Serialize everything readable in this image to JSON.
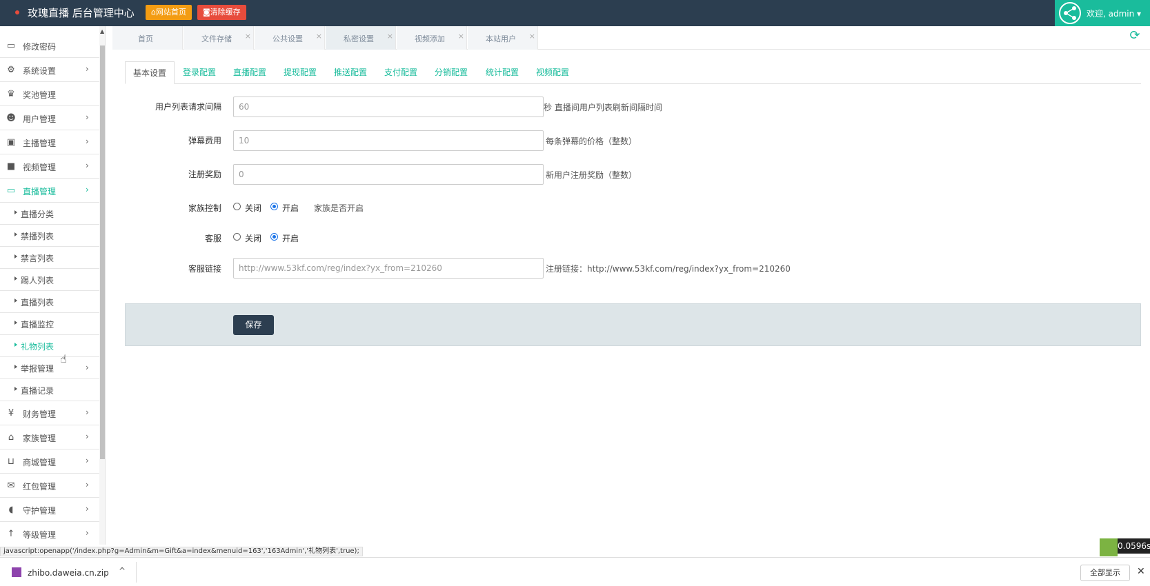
{
  "header": {
    "brand": "玫瑰直播 后台管理中心",
    "btn_home": "网站首页",
    "btn_cache": "清除缓存",
    "welcome": "欢迎, admin ▾"
  },
  "sidebar": {
    "items": [
      {
        "label": "修改密码",
        "icon": "monitor-icon",
        "arrow": false
      },
      {
        "label": "系统设置",
        "icon": "gears-icon",
        "arrow": true
      },
      {
        "label": "奖池管理",
        "icon": "trophy-icon",
        "arrow": false
      },
      {
        "label": "用户管理",
        "icon": "users-icon",
        "arrow": true
      },
      {
        "label": "主播管理",
        "icon": "id-badge-icon",
        "arrow": true
      },
      {
        "label": "视频管理",
        "icon": "video-camera-icon",
        "arrow": true
      },
      {
        "label": "直播管理",
        "icon": "desktop-icon",
        "arrow": true
      }
    ],
    "sub_items": [
      {
        "label": "直播分类"
      },
      {
        "label": "禁播列表"
      },
      {
        "label": "禁言列表"
      },
      {
        "label": "踢人列表"
      },
      {
        "label": "直播列表"
      },
      {
        "label": "直播监控"
      },
      {
        "label": "礼物列表"
      },
      {
        "label": "举报管理"
      },
      {
        "label": "直播记录"
      }
    ],
    "bottom_items": [
      {
        "label": "财务管理",
        "icon": "yen-icon"
      },
      {
        "label": "家族管理",
        "icon": "bank-icon"
      },
      {
        "label": "商城管理",
        "icon": "cart-icon"
      },
      {
        "label": "红包管理",
        "icon": "envelope-icon"
      },
      {
        "label": "守护管理",
        "icon": "shield-icon"
      },
      {
        "label": "等级管理",
        "icon": "level-up-icon"
      }
    ]
  },
  "page_tabs": [
    {
      "label": "首页",
      "closable": false
    },
    {
      "label": "文件存储",
      "closable": true
    },
    {
      "label": "公共设置",
      "closable": true
    },
    {
      "label": "私密设置",
      "closable": true
    },
    {
      "label": "视频添加",
      "closable": true
    },
    {
      "label": "本站用户",
      "closable": true
    }
  ],
  "settings_tabs": [
    "基本设置",
    "登录配置",
    "直播配置",
    "提现配置",
    "推送配置",
    "支付配置",
    "分销配置",
    "统计配置",
    "视频配置"
  ],
  "form": {
    "interval_label": "用户列表请求间隔",
    "interval_value": "60",
    "interval_hint": "秒 直播间用户列表刷新间隔时间",
    "barrage_label": "弹幕费用",
    "barrage_value": "10",
    "barrage_hint": "每条弹幕的价格（整数）",
    "reg_label": "注册奖励",
    "reg_value": "0",
    "reg_hint": "新用户注册奖励（整数）",
    "family_label": "家族控制",
    "family_off": "关闭",
    "family_on": "开启",
    "family_hint": "家族是否开启",
    "service_label": "客服",
    "service_off": "关闭",
    "service_on": "开启",
    "service_link_label": "客服链接",
    "service_link_value": "http://www.53kf.com/reg/index?yx_from=210260",
    "service_link_hint": "注册链接：http://www.53kf.com/reg/index?yx_from=210260",
    "save": "保存"
  },
  "status": {
    "url": "javascript:openapp('/index.php?g=Admin&m=Gift&a=index&menuid=163','163Admin','礼物列表',true);",
    "timer": "0.0596s"
  },
  "download": {
    "filename": "zhibo.daweia.cn.zip",
    "show_all": "全部显示"
  }
}
